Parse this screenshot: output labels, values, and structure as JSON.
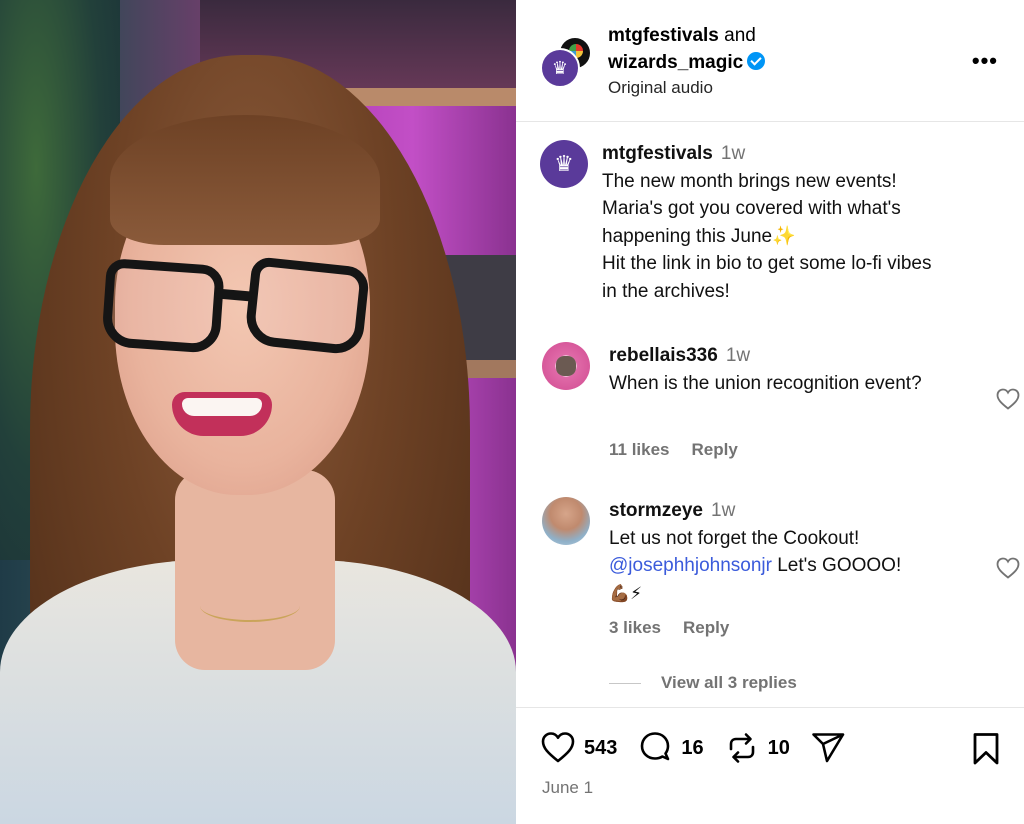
{
  "post": {
    "header": {
      "author_1": "mtgfestivals",
      "joiner": "and",
      "author_2": "wizards_magic",
      "audio": "Original audio",
      "more_label": "•••"
    },
    "caption": {
      "username": "mtgfestivals",
      "time": "1w",
      "lines": [
        "The new month brings new events!",
        "Maria's got you covered with what's",
        "happening this June✨",
        "Hit the link in bio to get some lo-fi vibes",
        "in the archives!"
      ]
    },
    "comments": [
      {
        "username": "rebellais336",
        "time": "1w",
        "text": "When is the union recognition event?",
        "likes": "11 likes",
        "reply": "Reply"
      },
      {
        "username": "stormzeye",
        "time": "1w",
        "text_1": "Let us not forget the Cookout!",
        "mention": "@josephhjohnsonjr",
        "text_2": " Let's GOOOO!",
        "emoji": "💪🏾⚡",
        "likes": "3 likes",
        "reply": "Reply"
      }
    ],
    "view_replies": "View all 3 replies",
    "stats": {
      "likes": "543",
      "comments": "16",
      "reposts": "10"
    },
    "date": "June 1"
  },
  "icons": {
    "logo_glyph": "♛",
    "accent": "#5a3a9a",
    "verified": "#0095f6"
  }
}
